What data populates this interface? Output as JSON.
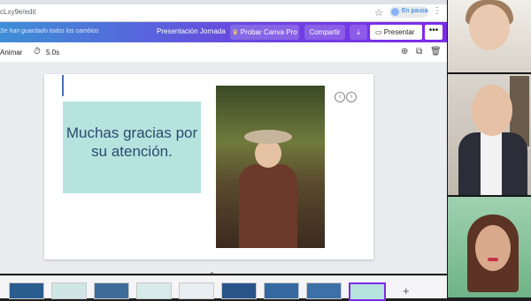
{
  "browser": {
    "url": "cLxy9e/edit",
    "profile_status": "En pausa"
  },
  "header": {
    "save_status": "Se han guardado todos los cambios",
    "title": "Presentación Jornada",
    "try_pro": "Probar Canva Pro",
    "share": "Compartir",
    "present": "Presentar",
    "accent_color": "#7d2ae8"
  },
  "toolbar": {
    "animate": "Animar",
    "duration": "5.0s"
  },
  "slide": {
    "text": "Muchas gracias por su atención.",
    "box_color": "#b7e3df",
    "text_color": "#2b4a6c"
  },
  "filmstrip": {
    "add_label": "+"
  }
}
